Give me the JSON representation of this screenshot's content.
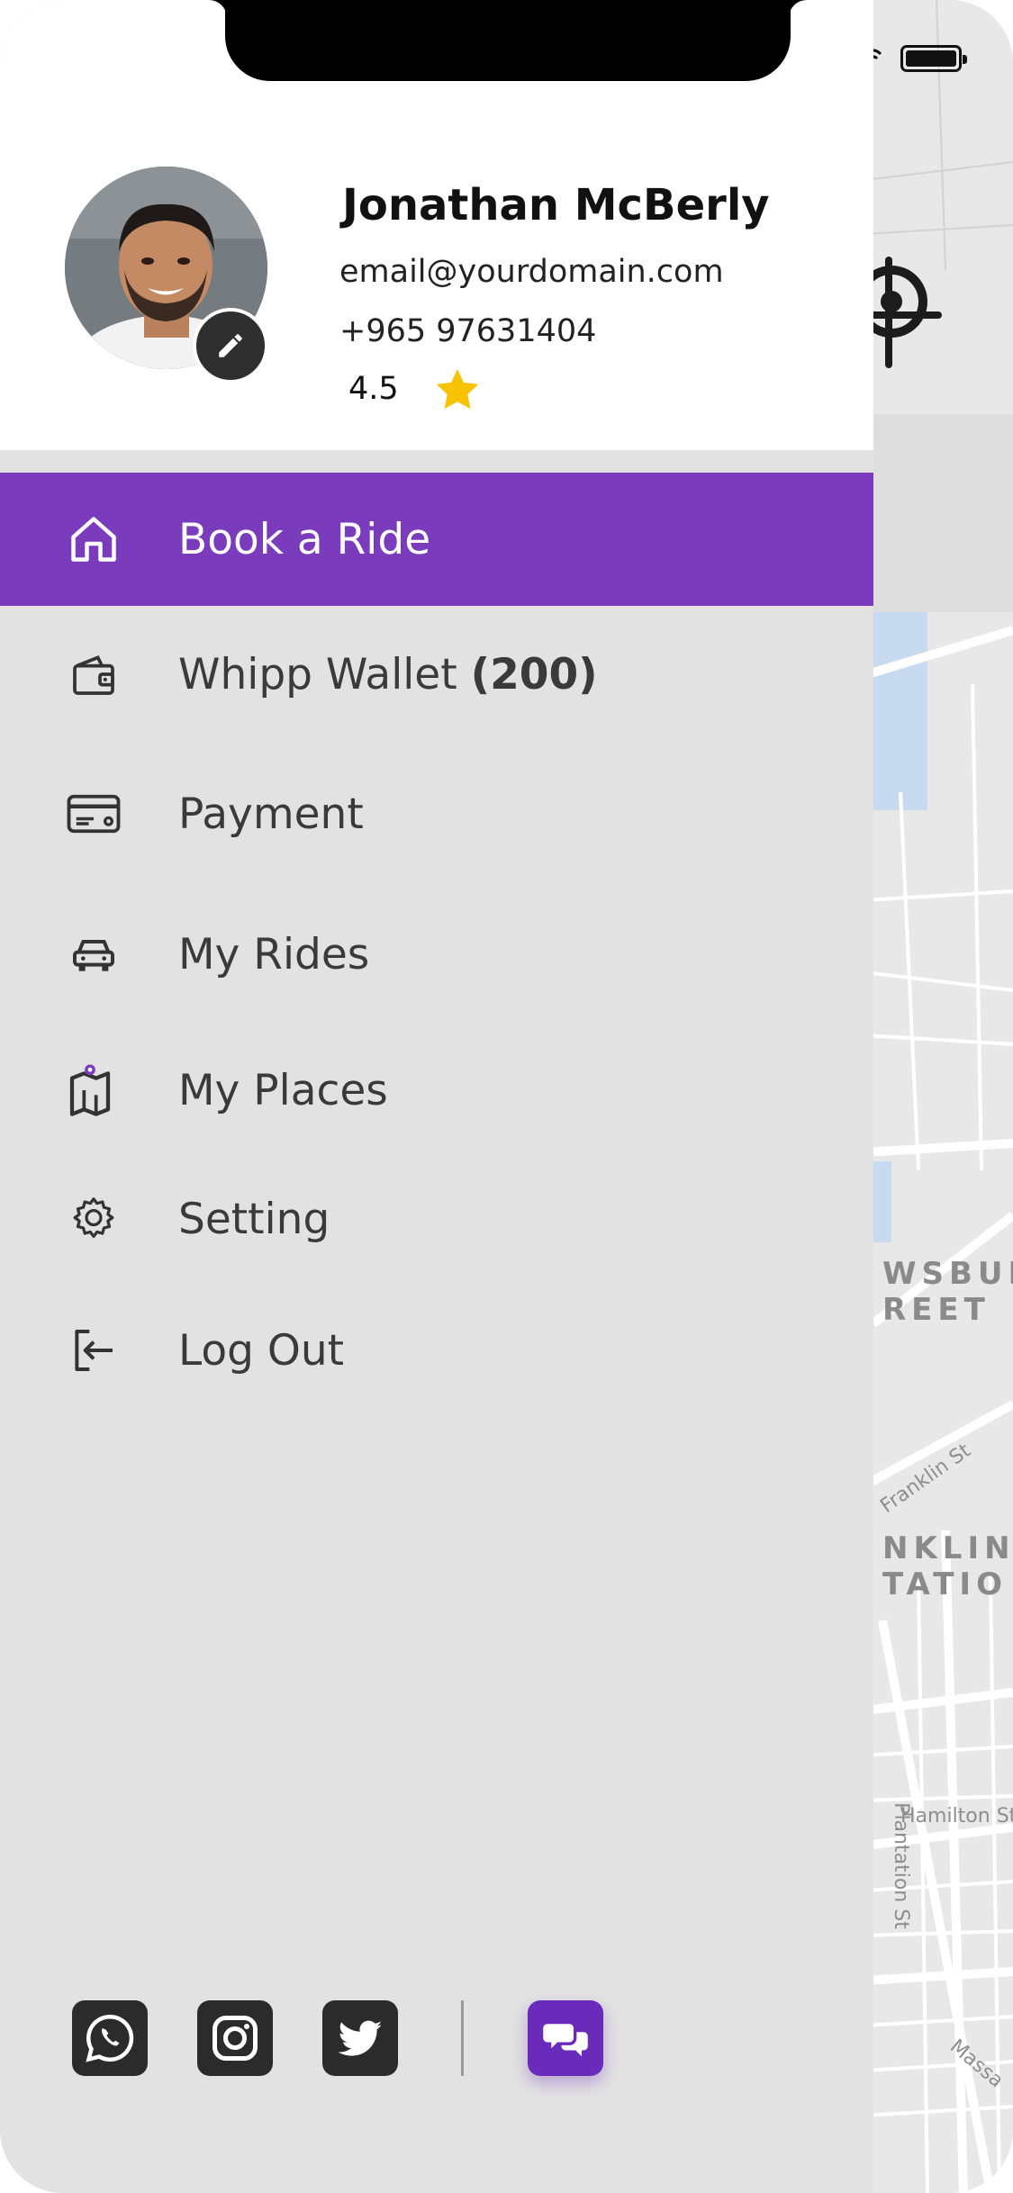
{
  "profile": {
    "name": "Jonathan McBerly",
    "email": "email@yourdomain.com",
    "phone": "+965 97631404",
    "rating": "4.5"
  },
  "menu": {
    "items": [
      {
        "label": "Book a Ride",
        "icon": "home-icon",
        "active": true
      },
      {
        "label": "Whipp Wallet ",
        "badge": "(200)",
        "icon": "wallet-icon",
        "active": false
      },
      {
        "label": "Payment",
        "icon": "credit-card-icon",
        "active": false
      },
      {
        "label": "My Rides",
        "icon": "car-icon",
        "active": false
      },
      {
        "label": "My Places",
        "icon": "map-pin-icon",
        "active": false
      },
      {
        "label": "Setting",
        "icon": "gear-icon",
        "active": false
      },
      {
        "label": "Log Out",
        "icon": "logout-icon",
        "active": false
      }
    ]
  },
  "social": {
    "items": [
      "whatsapp-icon",
      "instagram-icon",
      "twitter-icon"
    ],
    "chat": "chat-icon"
  },
  "map": {
    "labels": [
      "WSBUR",
      "REET",
      "NKLIN",
      "TATIO"
    ],
    "streets": [
      "Franklin St",
      "Hamilton St",
      "Plantation St",
      "Massa"
    ]
  },
  "colors": {
    "accent": "#7a3bbd",
    "drawer_bg": "#e2e2e2",
    "header_bg": "#ffffff",
    "star": "#f7c300"
  }
}
